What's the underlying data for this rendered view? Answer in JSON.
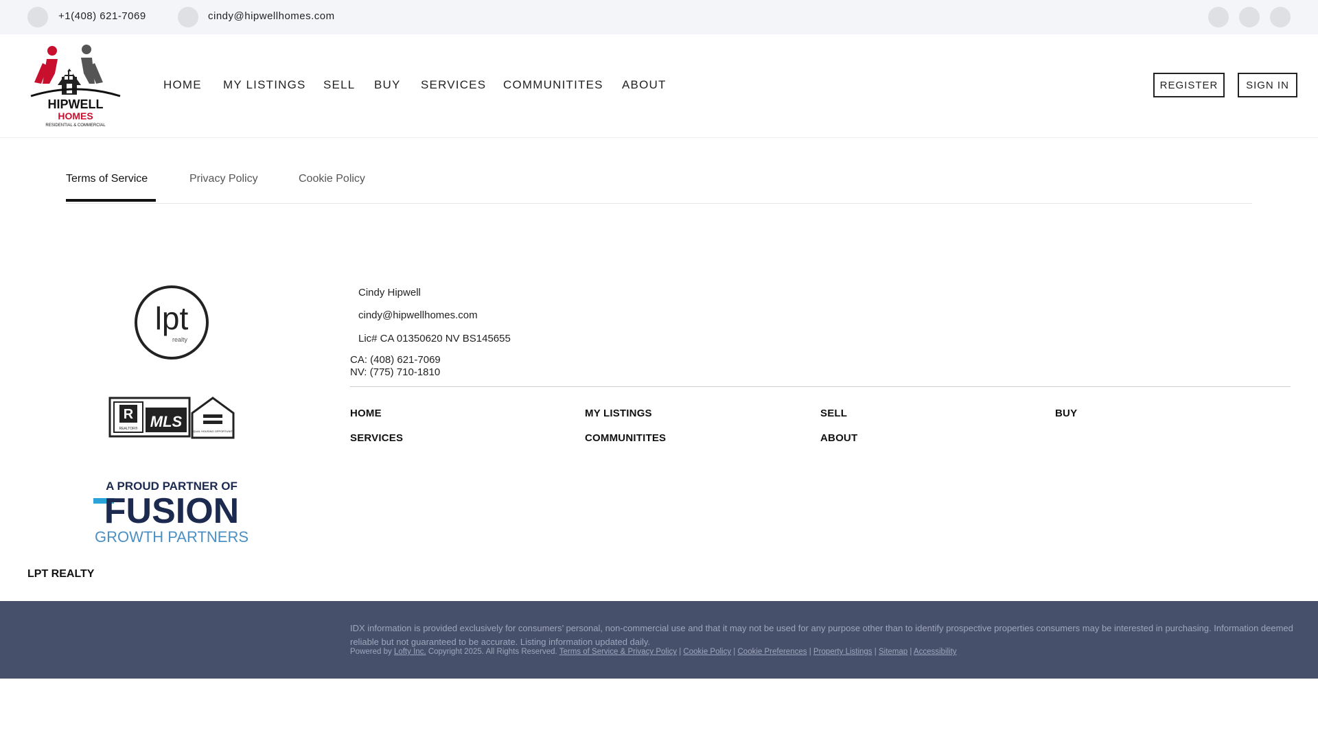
{
  "topbar": {
    "phone": "+1(408) 621-7069",
    "email": "cindy@hipwellhomes.com",
    "phone_icon": "phone-icon",
    "email_icon": "email-icon",
    "social_icons": [
      "social-icon-1",
      "social-icon-2",
      "social-icon-3"
    ]
  },
  "header": {
    "logo": {
      "top": "HIPWELL",
      "mid": "HOMES",
      "sub": "RESIDENTIAL & COMMERCIAL"
    },
    "nav": [
      "HOME",
      "MY LISTINGS",
      "SELL",
      "BUY",
      "SERVICES",
      "COMMUNITITES",
      "ABOUT"
    ],
    "register_label": "REGISTER",
    "signin_label": "SIGN IN"
  },
  "tabs": [
    "Terms of Service",
    "Privacy Policy",
    "Cookie Policy"
  ],
  "active_tab": "Terms of Service",
  "footer": {
    "lpt_logo": {
      "main": "lpt",
      "sub": "realty"
    },
    "mls_logo": {
      "realtor": "REALTOR®",
      "mls": "MLS",
      "equal": "EQUAL HOUSING OPPORTUNITY"
    },
    "fusion_logo": {
      "line1": "A PROUD PARTNER OF",
      "line2": "FUSION",
      "line3": "GROWTH PARTNERS"
    },
    "name": "Cindy Hipwell",
    "email": "cindy@hipwellhomes.com",
    "license": "Lic# CA 01350620 NV BS145655",
    "ca_phone": "CA: (408) 621-7069",
    "nv_phone": "NV: (775) 710-1810",
    "links": [
      "HOME",
      "MY LISTINGS",
      "SELL",
      "BUY",
      "SERVICES",
      "COMMUNITITES",
      "ABOUT"
    ],
    "company": "LPT REALTY"
  },
  "bottom": {
    "idx": "IDX information is provided exclusively for consumers’ personal, non-commercial use and that it may not be used for any purpose other than to identify prospective properties consumers may be interested in purchasing. Information deemed reliable but not guaranteed to be accurate. Listing information updated daily.",
    "powered_by": "Powered by",
    "lofty": "Lofty Inc.",
    "copyright": "Copyright 2025. All Rights Reserved.",
    "tos": "Terms of Service & Privacy Policy",
    "cookie": "Cookie Policy",
    "cookie_pref": "Cookie Preferences",
    "listings": "Property Listings",
    "sitemap": "Sitemap",
    "accessibility": "Accessibility",
    "separator": "|"
  },
  "colors": {
    "logo_red": "#c8102e",
    "footer_bg": "#46506b",
    "fusion_blue": "#2aa3d9",
    "fusion_navy": "#1c2a4f"
  }
}
